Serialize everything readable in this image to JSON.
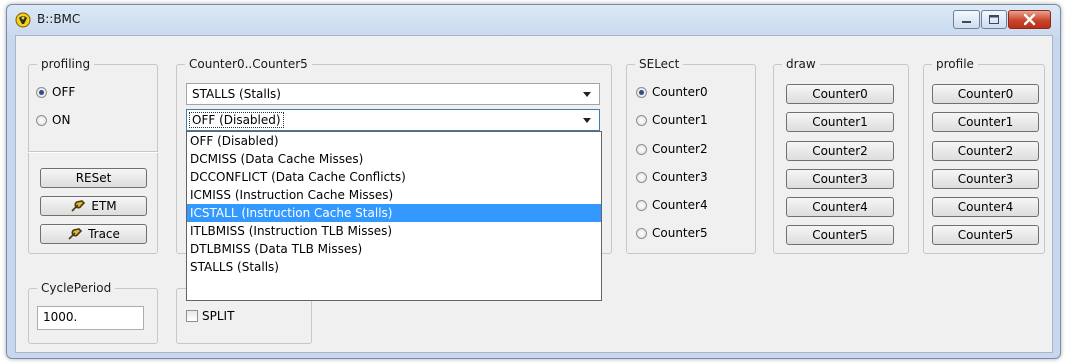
{
  "window": {
    "title": "B::BMC",
    "controls": {
      "minimize_icon": "minimize-icon",
      "maximize_icon": "maximize-icon",
      "close_icon": "close-icon"
    }
  },
  "profiling": {
    "legend": "profiling",
    "options": [
      {
        "label": "OFF",
        "selected": true
      },
      {
        "label": "ON",
        "selected": false
      }
    ],
    "reset_label": "RESet",
    "etm_label": "ETM",
    "trace_label": "Trace"
  },
  "counters": {
    "legend": "Counter0..Counter5",
    "combo0_value": "STALLS (Stalls)",
    "combo1_value": "OFF (Disabled)",
    "dropdown_options": [
      "OFF (Disabled)",
      "DCMISS (Data Cache Misses)",
      "DCCONFLICT (Data Cache Conflicts)",
      "ICMISS (Instruction Cache Misses)",
      "ICSTALL (Instruction Cache Stalls)",
      "ITLBMISS (Instruction TLB Misses)",
      "DTLBMISS (Data TLB Misses)",
      "STALLS (Stalls)"
    ],
    "highlighted_option": "ICSTALL (Instruction Cache Stalls)"
  },
  "select": {
    "legend": "SELect",
    "options": [
      "Counter0",
      "Counter1",
      "Counter2",
      "Counter3",
      "Counter4",
      "Counter5"
    ],
    "selected": "Counter0"
  },
  "draw": {
    "legend": "draw",
    "buttons": [
      "Counter0",
      "Counter1",
      "Counter2",
      "Counter3",
      "Counter4",
      "Counter5"
    ]
  },
  "profile": {
    "legend": "profile",
    "buttons": [
      "Counter0",
      "Counter1",
      "Counter2",
      "Counter3",
      "Counter4",
      "Counter5"
    ]
  },
  "cycle_period": {
    "legend": "CyclePeriod",
    "value": "1000."
  },
  "split": {
    "label": "SPLIT",
    "checked": false
  },
  "colors": {
    "highlight": "#3399ff",
    "close_button": "#c8452c",
    "titlebar": "#c7d8ee"
  }
}
